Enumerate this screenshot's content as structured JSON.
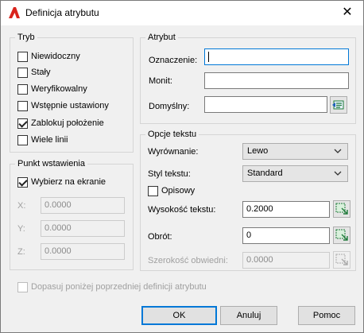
{
  "window": {
    "title": "Definicja atrybutu",
    "close_glyph": "✕"
  },
  "mode": {
    "title": "Tryb",
    "items": [
      {
        "label": "Niewidoczny",
        "checked": false
      },
      {
        "label": "Stały",
        "checked": false
      },
      {
        "label": "Weryfikowalny",
        "checked": false
      },
      {
        "label": "Wstępnie ustawiony",
        "checked": false
      },
      {
        "label": "Zablokuj położenie",
        "checked": true
      },
      {
        "label": "Wiele linii",
        "checked": false
      }
    ]
  },
  "insertion": {
    "title": "Punkt wstawienia",
    "specify_onscreen": {
      "label": "Wybierz na ekranie",
      "checked": true
    },
    "x": {
      "label": "X:",
      "value": "0.0000"
    },
    "y": {
      "label": "Y:",
      "value": "0.0000"
    },
    "z": {
      "label": "Z:",
      "value": "0.0000"
    }
  },
  "attribute": {
    "title": "Atrybut",
    "tag": {
      "label": "Oznaczenie:",
      "value": ""
    },
    "prompt": {
      "label": "Monit:",
      "value": ""
    },
    "default": {
      "label": "Domyślny:",
      "value": ""
    }
  },
  "text_settings": {
    "title": "Opcje tekstu",
    "justification": {
      "label": "Wyrównanie:",
      "value": "Lewo"
    },
    "text_style": {
      "label": "Styl tekstu:",
      "value": "Standard"
    },
    "annotative": {
      "label": "Opisowy",
      "checked": false
    },
    "text_height": {
      "label": "Wysokość tekstu:",
      "value": "0.2000"
    },
    "rotation": {
      "label": "Obrót:",
      "value": "0"
    },
    "boundary_width": {
      "label": "Szerokość obwiedni:",
      "value": "0.0000"
    }
  },
  "align_below": {
    "label": "Dopasuj poniżej poprzedniej definicji atrybutu",
    "checked": false
  },
  "buttons": {
    "ok": "OK",
    "cancel": "Anuluj",
    "help": "Pomoc"
  },
  "colors": {
    "accent": "#0078d7",
    "app_icon": "#d9241c",
    "pick_icon": "#1f7a3a"
  }
}
